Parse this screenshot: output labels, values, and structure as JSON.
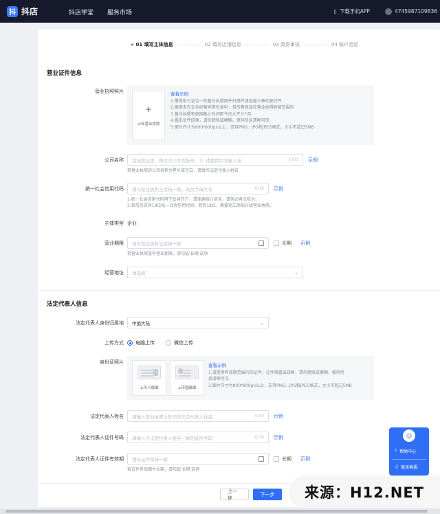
{
  "topbar": {
    "logo_glyph": "抖",
    "logo_text": "抖店",
    "nav": [
      "抖店学堂",
      "服务市场"
    ],
    "download_label": "下载手机APP",
    "account_id": "4745987109836"
  },
  "steps": [
    {
      "label": "01 填写主体信息",
      "active": true
    },
    {
      "label": "02 填写店铺信息",
      "active": false
    },
    {
      "label": "03 资质审核",
      "active": false
    },
    {
      "label": "04 账户验证",
      "active": false
    }
  ],
  "license": {
    "section_title": "营业证件信息",
    "photo_label": "营业执照照片",
    "upload_plus": "+",
    "upload_text": "上传营业执照",
    "guide_link": "查看示例",
    "guide_lines": [
      "1.需提供三证合一的营业执照原件扫描件或加盖公章的复印件",
      "2.确保未在企业经营异常名录中，且所售商品在营业执照经营范围内",
      "3.营业执照有效期截止时间距今应大于3个月",
      "4.露出证件四角，请勿遮挡或模糊，保持信息清晰可见",
      "5.图片尺寸为800*800px以上，支持PNG、JPG和JPEG格式，大小不超过5MB"
    ],
    "company_label": "公司名称",
    "company_placeholder": "包括营业执、再次大小写及括号、（）请使用中文输入法",
    "company_count": "0/30",
    "company_example": "示例",
    "company_hint": "若营业执照的公司名称为星号或空白，请填写法定代表人姓名",
    "credit_label": "统一社会信用代码",
    "credit_placeholder": "请与营业执照上保持一致，英文字母大写",
    "credit_count": "0/18",
    "credit_example": "示例",
    "credit_hints": [
      "1.统一社会信用代码用于后续开户，请准确核心信息，请务必再次核对；",
      "2.若前仅支持18位统一社会信用代码，若你18位，需要到工商局升级营业执照。"
    ],
    "entity_type_label": "主体类型",
    "entity_type_value": "企业",
    "period_label": "营业期限",
    "period_placeholder": "请与营业执照上保持一致",
    "period_long_label": "长期",
    "period_example": "示例",
    "period_hint": "若营业执照没有营业期限，请勾选'长期'选项",
    "address_label": "经营地址",
    "address_placeholder": "请选择"
  },
  "legal": {
    "section_title": "法定代表人信息",
    "region_label": "法定代表人身份归属地",
    "region_value": "中国大陆",
    "upload_method_label": "上传方式",
    "method_computer": "电脑上传",
    "method_wechat": "微信上传",
    "id_photo_label": "身份证照片",
    "id_front_label": "上传人像面",
    "id_back_label": "上传国徽面",
    "id_guide_link": "查看示例",
    "id_guide_lines": [
      "1.请提供有效期范围内的证件，证件需露出四角，请勿遮挡或模糊，保持信",
      "息清晰可见",
      "2.图片尺寸为800*800px以上，支持PNG、JPG和JPEG格式，大小不超过5MB"
    ],
    "name_label": "法定代表人姓名",
    "name_placeholder": "请输入营业执照上登记的法定代表人姓名",
    "name_count": "0/40",
    "name_example": "示例",
    "id_number_label": "法定代表人证件号码",
    "id_number_placeholder": "请输入与法定代表人姓名一致的证件号码",
    "id_number_count": "0/18",
    "id_number_example": "示例",
    "id_validity_label": "法定代表人证件有效期",
    "id_validity_placeholder": "请与证件保持一致",
    "id_validity_long_label": "长期",
    "id_validity_example": "示例",
    "id_validity_hint": "若证件有效期为长期，请勾选'长期'选项"
  },
  "footer": {
    "prev_label": "上一步",
    "next_label": "下一步"
  },
  "side_widget": {
    "help_label": "帮助中心",
    "contact_label": "联系客服"
  },
  "watermark": {
    "text": "来源：H12.NET"
  },
  "colors": {
    "topbar_bg": "#171a2c",
    "primary": "#2f6ff5",
    "page_bg": "#eef0f3"
  }
}
